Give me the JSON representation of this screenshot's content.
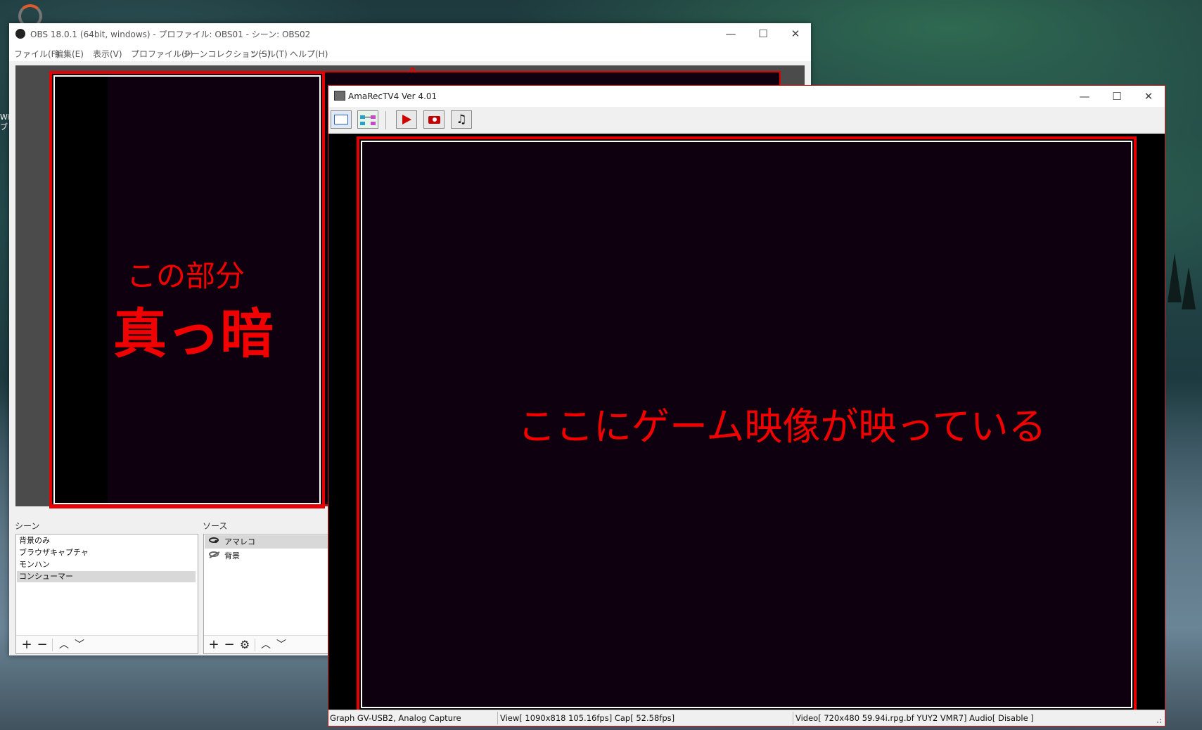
{
  "desktop": {
    "side_text": "Wir\nブレ"
  },
  "obs": {
    "title": "OBS 18.0.1 (64bit, windows) - プロファイル: OBS01 - シーン: OBS02",
    "menu": [
      "ファイル(F)",
      "編集(E)",
      "表示(V)",
      "プロファイル(P)",
      "シーンコレクション(S)",
      "ツール(T)",
      "ヘルプ(H)"
    ],
    "scenes_label": "シーン",
    "sources_label": "ソース",
    "scenes": [
      "背景のみ",
      "ブラウザキャプチャ",
      "モンハン",
      "コンシューマー"
    ],
    "selected_scene_index": 3,
    "sources": [
      {
        "name": "アマレコ",
        "visible": true
      },
      {
        "name": "背景",
        "visible": false
      }
    ],
    "toolbar_icons": {
      "add": "+",
      "remove": "−",
      "up": "︿",
      "down": "﹀",
      "settings": "⚙"
    }
  },
  "amarec": {
    "title": "AmaRecTV4 Ver 4.01",
    "status": {
      "device": "Graph GV-USB2, Analog Capture",
      "view": "View[ 1090x818 105.16fps]  Cap[ 52.58fps]",
      "video": "Video[ 720x480 59.94i.rpg.bf YUY2 VMR7]  Audio[ Disable ]"
    },
    "toolbar_icons": [
      "window-icon",
      "graph-icon",
      "play-icon",
      "camera-icon",
      "music-note-icon"
    ]
  },
  "annotations": {
    "left_small": "この部分",
    "left_big": "真っ暗",
    "right": "ここにゲーム映像が映っている",
    "color": "#f20000"
  },
  "window_controls": {
    "minimize": "—",
    "maximize": "☐",
    "close": "✕"
  }
}
